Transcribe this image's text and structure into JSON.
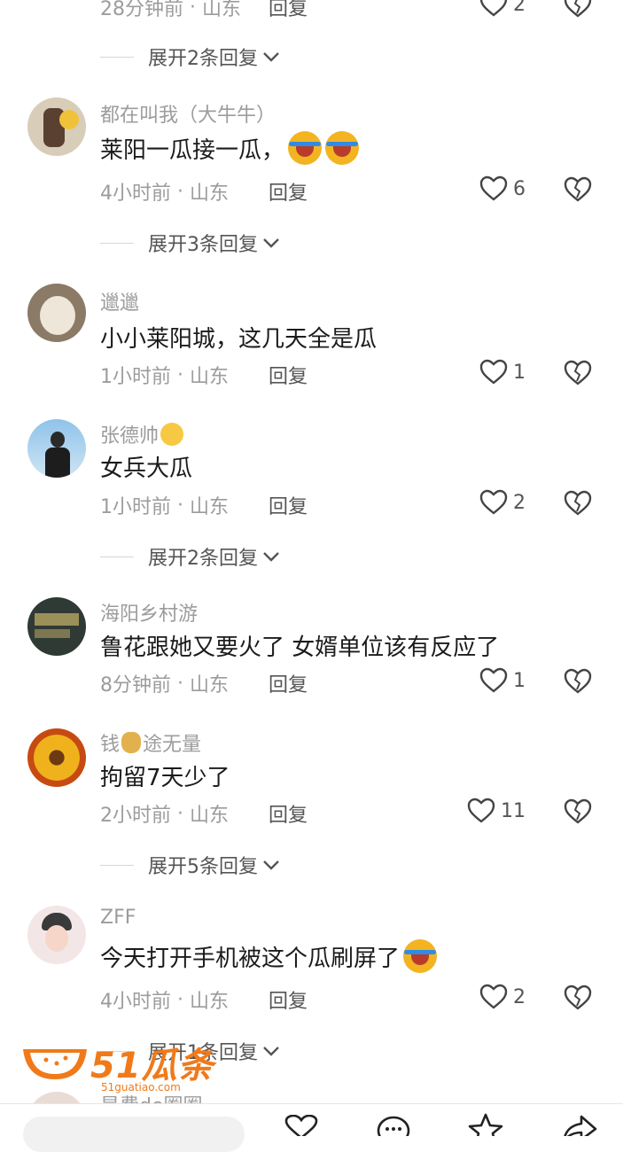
{
  "top": {
    "time": "28分钟前",
    "location": "山东",
    "reply": "回复",
    "likes": "2",
    "expand": "展开2条回复"
  },
  "comments": [
    {
      "user": "都在叫我（大牛牛）",
      "text": "莱阳一瓜接一瓜，",
      "time": "4小时前",
      "location": "山东",
      "reply": "回复",
      "likes": "6",
      "expand": "展开3条回复"
    },
    {
      "user": "邋邋",
      "text": "小小莱阳城，这几天全是瓜",
      "time": "1小时前",
      "location": "山东",
      "reply": "回复",
      "likes": "1"
    },
    {
      "user": "张德帅",
      "text": "女兵大瓜",
      "time": "1小时前",
      "location": "山东",
      "reply": "回复",
      "likes": "2",
      "expand": "展开2条回复"
    },
    {
      "user": "海阳乡村游",
      "text": "鲁花跟她又要火了 女婿单位该有反应了",
      "time": "8分钟前",
      "location": "山东",
      "reply": "回复",
      "likes": "1"
    },
    {
      "user_a": "钱",
      "user_b": "途无量",
      "text": "拘留7天少了",
      "time": "2小时前",
      "location": "山东",
      "reply": "回复",
      "likes": "11",
      "expand": "展开5条回复"
    },
    {
      "user": "ZFF",
      "text": "今天打开手机被这个瓜刷屏了",
      "time": "4小时前",
      "location": "山东",
      "reply": "回复",
      "likes": "2",
      "expand": "展开1条回复"
    }
  ],
  "partial_user": "是费de圈圈",
  "watermark": {
    "logo": "51瓜条",
    "url": "51guatiao.com"
  },
  "colors": {
    "text": "#1b1b1b",
    "muted": "#9c9c9c",
    "accent": "#f07a1a"
  }
}
